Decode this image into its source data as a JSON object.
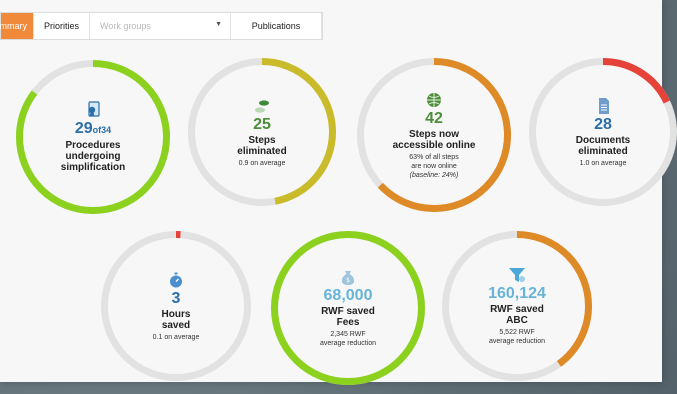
{
  "tabs": {
    "summary": "ummary",
    "priorities": "Priorities",
    "workgroups_placeholder": "Work groups",
    "publications": "Publications"
  },
  "metrics": [
    {
      "id": "procedures",
      "value": "29",
      "of": "of34",
      "title_lines": [
        "Procedures",
        "undergoing",
        "simplification"
      ],
      "sub_lines": [],
      "fraction": 0.853,
      "ring_color": "#8bd11e",
      "value_color": "#2b6fa8",
      "icon": "certificate-icon"
    },
    {
      "id": "steps",
      "value": "25",
      "title_lines": [
        "Steps",
        "eliminated"
      ],
      "sub_lines": [
        "0.9 on average"
      ],
      "fraction": 0.47,
      "ring_color": "#c9bb2a",
      "value_color": "#4b8d3a",
      "icon": "footsteps-icon"
    },
    {
      "id": "online",
      "value": "42",
      "title_lines": [
        "Steps now",
        "accessible online"
      ],
      "sub_lines": [
        "63% of all steps",
        "are now online",
        "(baseline: 24%)"
      ],
      "fraction": 0.63,
      "ring_color": "#de8a26",
      "value_color": "#4b8d3a",
      "icon": "globe-icon"
    },
    {
      "id": "documents",
      "value": "28",
      "title_lines": [
        "Documents",
        "eliminated"
      ],
      "sub_lines": [
        "1.0 on average"
      ],
      "fraction": 0.18,
      "ring_color": "#e5433a",
      "value_color": "#2b6fa8",
      "icon": "document-icon"
    },
    {
      "id": "hours",
      "value": "3",
      "title_lines": [
        "Hours",
        "saved"
      ],
      "sub_lines": [
        "0.1 on average"
      ],
      "fraction": 0.01,
      "ring_color": "#e5433a",
      "value_color": "#2b6fa8",
      "icon": "stopwatch-icon"
    },
    {
      "id": "fees",
      "value": "68,000",
      "title_lines": [
        "RWF saved",
        "Fees"
      ],
      "sub_lines": [
        "2,345 RWF",
        "average reduction"
      ],
      "fraction": 1.0,
      "ring_color": "#8bd11e",
      "value_color": "#67b4d8",
      "icon": "money-bag-icon"
    },
    {
      "id": "abc",
      "value": "160,124",
      "title_lines": [
        "RWF saved",
        "ABC"
      ],
      "sub_lines": [
        "5,522 RWF",
        "average reduction"
      ],
      "fraction": 0.4,
      "ring_color": "#de8a26",
      "value_color": "#67b4d8",
      "icon": "funnel-icon"
    }
  ]
}
